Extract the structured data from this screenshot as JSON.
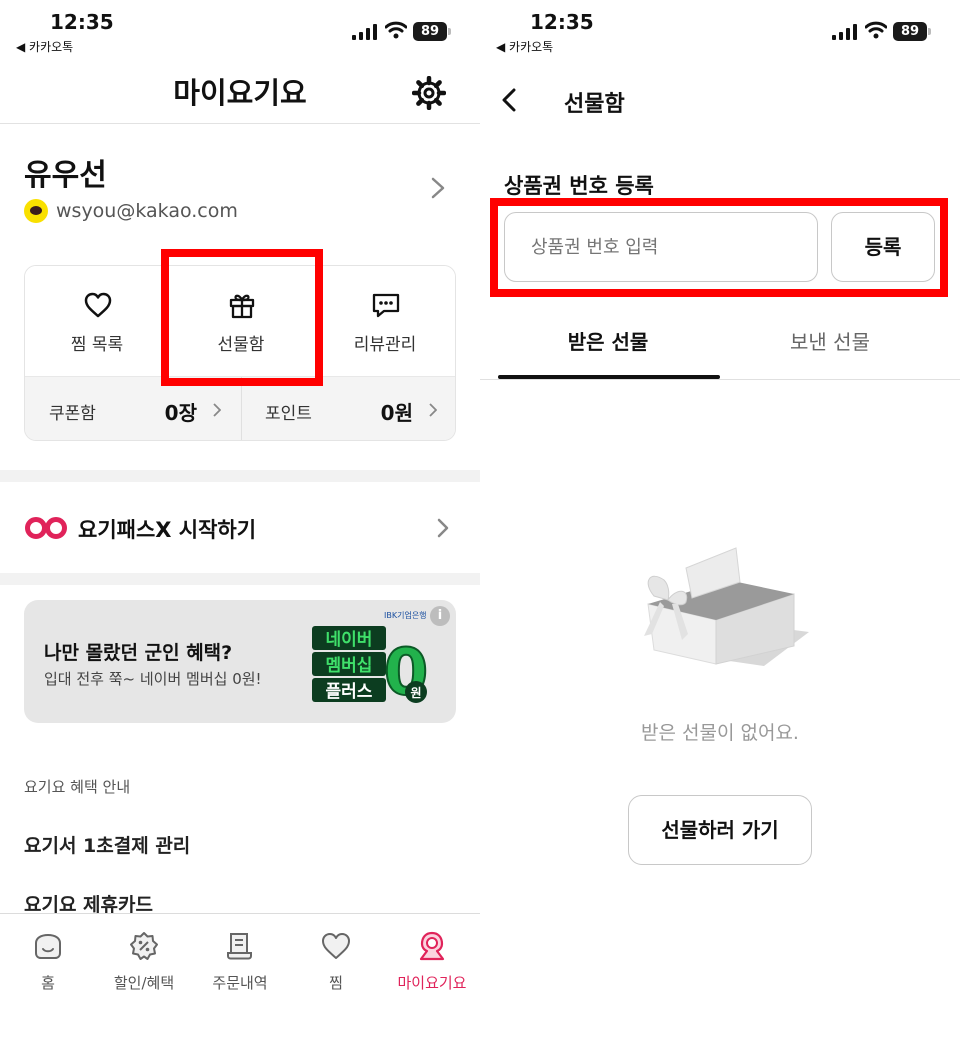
{
  "status_bar": {
    "time": "12:35",
    "back_app": "◀ 카카오톡",
    "battery": "89"
  },
  "left": {
    "header": {
      "title": "마이요기요"
    },
    "profile": {
      "name": "유우선",
      "email": "wsyou@kakao.com"
    },
    "quick_actions": [
      {
        "label": "찜 목록",
        "icon": "heart-icon"
      },
      {
        "label": "선물함",
        "icon": "gift-icon"
      },
      {
        "label": "리뷰관리",
        "icon": "review-chat-icon"
      }
    ],
    "coupon": {
      "label": "쿠폰함",
      "value": "0장"
    },
    "points": {
      "label": "포인트",
      "value": "0원"
    },
    "pass": {
      "label": "요기패스X 시작하기"
    },
    "banner": {
      "title": "나만 몰랐던 군인 혜택?",
      "subtitle": "입대 전후 쭉~ 네이버 멤버십 0원!",
      "sponsor": "IBK기업은행",
      "info": "i",
      "promo_line1": "네이버",
      "promo_line2": "멤버십",
      "promo_line3": "플러스",
      "promo_zero": "0",
      "promo_won": "원"
    },
    "section_label": "요기요 혜택 안내",
    "menu": [
      "요기서 1초결제 관리",
      "요기요 제휴카드"
    ],
    "tabbar": [
      {
        "label": "홈",
        "icon": "home-icon"
      },
      {
        "label": "할인/혜택",
        "icon": "discount-icon"
      },
      {
        "label": "주문내역",
        "icon": "receipt-icon"
      },
      {
        "label": "찜",
        "icon": "heart-icon"
      },
      {
        "label": "마이요기요",
        "icon": "my-profile-icon"
      }
    ],
    "accent": "#e0235a"
  },
  "right": {
    "header": {
      "title": "선물함"
    },
    "register": {
      "label": "상품권 번호 등록",
      "placeholder": "상품권 번호 입력",
      "button": "등록"
    },
    "tabs": {
      "received": "받은 선물",
      "sent": "보낸 선물"
    },
    "empty_text": "받은 선물이 없어요.",
    "go_button": "선물하러 가기"
  },
  "highlight_color": "#ff0000"
}
